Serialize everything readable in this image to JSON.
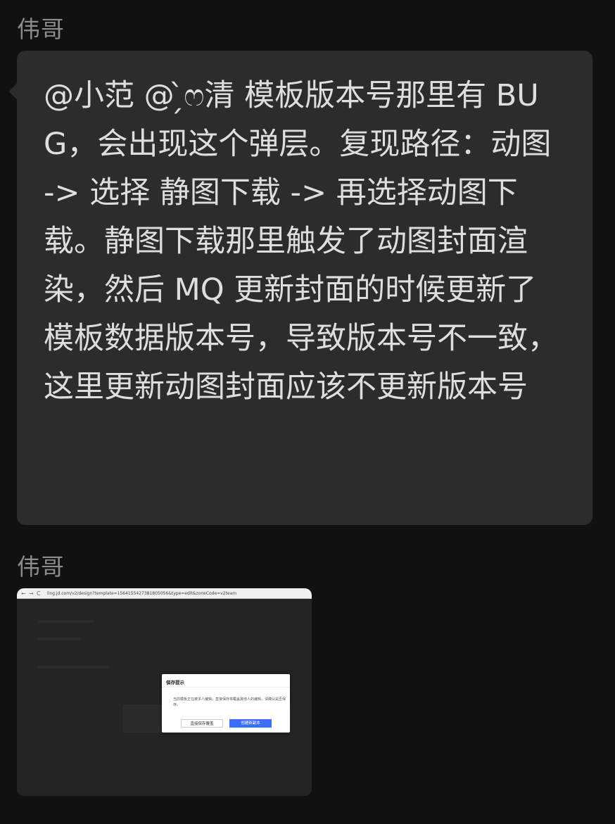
{
  "messages": [
    {
      "sender": "伟哥",
      "text": "@小范 @ ̗̀ෆ清 模板版本号那里有 BUG，会出现这个弹层。复现路径：动图 -> 选择 静图下载 -> 再选择动图下载。静图下载那里触发了动图封面渲染，然后 MQ 更新封面的时候更新了模板数据版本号，导致版本号不一致，这里更新动图封面应该不更新版本号"
    },
    {
      "sender": "伟哥",
      "image": {
        "browser": {
          "back_icon": "←",
          "forward_icon": "→",
          "reload_icon": "C",
          "url": "ling.jd.com/v2/design?template=1564155427381805056&type=edit&zoneCode=v2team"
        },
        "dialog": {
          "title": "保存提示",
          "body": "当前模板正在被多人编辑，直接保存将覆盖其他人的编辑，请确认是否保存。",
          "secondary_button": "直接保存覆盖",
          "primary_button": "创建新副本"
        }
      }
    }
  ],
  "colors": {
    "background": "#111111",
    "bubble": "#2c2c2c",
    "sender": "#8c8c8c",
    "text": "#dedede",
    "primary_button": "#3b6ff5"
  }
}
